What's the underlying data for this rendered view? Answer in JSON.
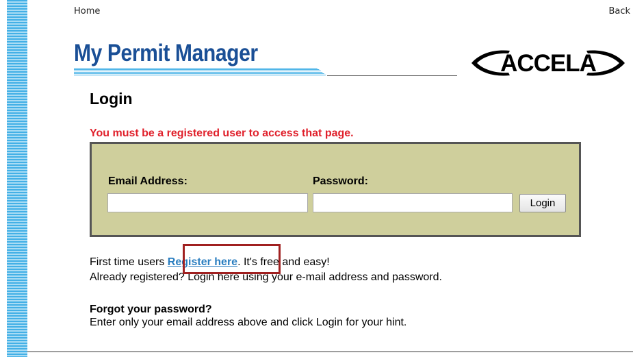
{
  "nav": {
    "home": "Home",
    "back": "Back"
  },
  "brand": {
    "title": "My Permit Manager",
    "logo_text": "ACCELA"
  },
  "login": {
    "heading": "Login",
    "error": "You must be a registered user to access that page.",
    "email_label": "Email Address:",
    "email_value": "",
    "password_label": "Password:",
    "password_value": "",
    "button": "Login"
  },
  "info": {
    "first_prefix": "First time users ",
    "register_link": "Register here",
    "first_suffix": ". It's free and easy!",
    "already": "Already registered? Login here using your e-mail address and password."
  },
  "forgot": {
    "title": "Forgot your password?",
    "text": "Enter only your email address above and click Login for your hint."
  },
  "colors": {
    "brand_blue": "#1a4f96",
    "stripe_blue": "#43b0e6",
    "error_red": "#e0202b",
    "box_bg": "#cfcf9c",
    "link_blue": "#2a7ec0",
    "highlight_red": "#a02020"
  }
}
